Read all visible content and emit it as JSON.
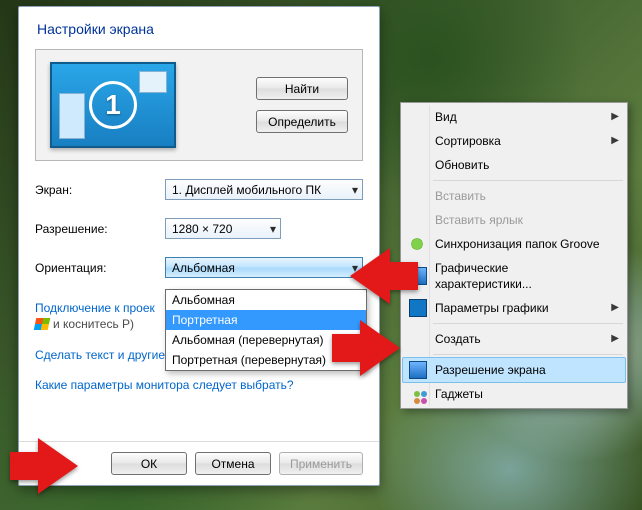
{
  "dialog": {
    "title": "Настройки экрана",
    "monitor_number": "1",
    "find_btn": "Найти",
    "detect_btn": "Определить",
    "labels": {
      "display": "Экран:",
      "resolution": "Разрешение:",
      "orientation": "Ориентация:"
    },
    "display_value": "1. Дисплей мобильного ПК",
    "resolution_value": "1280 × 720",
    "orientation_value": "Альбомная",
    "orientation_options": [
      "Альбомная",
      "Портретная",
      "Альбомная (перевернутая)",
      "Портретная (перевернутая)"
    ],
    "orientation_selected_index": 1,
    "projector_link_line1": "Подключение к проек",
    "projector_link_line2": "и коснитесь P)",
    "textsize_link": "Сделать текст и другие элементы больше или меньше",
    "whichparams_link": "Какие параметры монитора следует выбрать?",
    "ok_btn": "ОК",
    "cancel_btn": "Отмена",
    "apply_btn": "Применить"
  },
  "context_menu": {
    "items": [
      {
        "label": "Вид",
        "submenu": true
      },
      {
        "label": "Сортировка",
        "submenu": true
      },
      {
        "label": "Обновить"
      },
      {
        "sep": true
      },
      {
        "label": "Вставить",
        "disabled": true
      },
      {
        "label": "Вставить ярлык",
        "disabled": true
      },
      {
        "label": "Синхронизация папок Groove",
        "icon": "groove",
        "clipped": true
      },
      {
        "label": "Графические характеристики...",
        "icon": "gfx",
        "clipped": true
      },
      {
        "label": "Параметры графики",
        "icon": "intel",
        "submenu": true,
        "clipped": true
      },
      {
        "sep": true
      },
      {
        "label": "Создать",
        "submenu": true
      },
      {
        "sep": true
      },
      {
        "label": "Разрешение экрана",
        "icon": "res",
        "highlight": true
      },
      {
        "label": "Гаджеты",
        "icon": "gadget"
      }
    ]
  }
}
